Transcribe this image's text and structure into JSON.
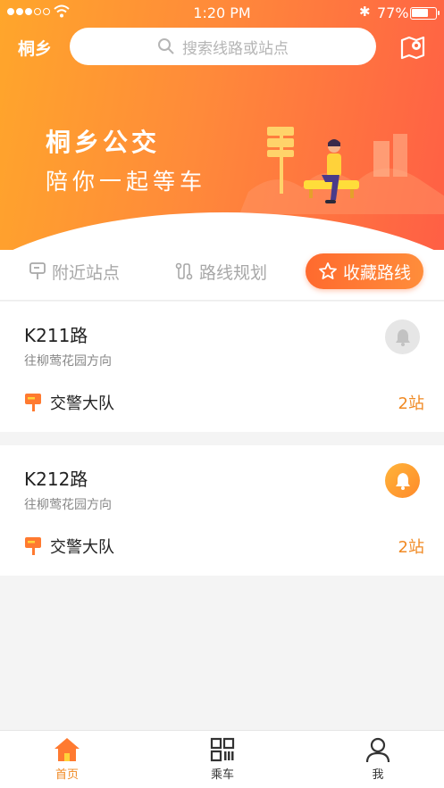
{
  "status_bar": {
    "time": "1:20 PM",
    "battery": "77%"
  },
  "header": {
    "city": "桐乡",
    "search_placeholder": "搜索线路或站点"
  },
  "banner": {
    "line1": "桐乡公交",
    "line2": "陪你一起等车"
  },
  "tabs": [
    {
      "label": "附近站点",
      "active": false
    },
    {
      "label": "路线规划",
      "active": false
    },
    {
      "label": "收藏路线",
      "active": true
    }
  ],
  "routes": [
    {
      "name": "K211路",
      "direction": "往柳莺花园方向",
      "stop": "交警大队",
      "distance": "2站",
      "reminder_on": false
    },
    {
      "name": "K212路",
      "direction": "往柳莺花园方向",
      "stop": "交警大队",
      "distance": "2站",
      "reminder_on": true
    }
  ],
  "bottom_nav": [
    {
      "label": "首页",
      "active": true
    },
    {
      "label": "乘车",
      "active": false
    },
    {
      "label": "我",
      "active": false
    }
  ],
  "colors": {
    "accent": "#f08a24",
    "hero_start": "#ffa62b",
    "hero_end": "#ff5f45"
  }
}
